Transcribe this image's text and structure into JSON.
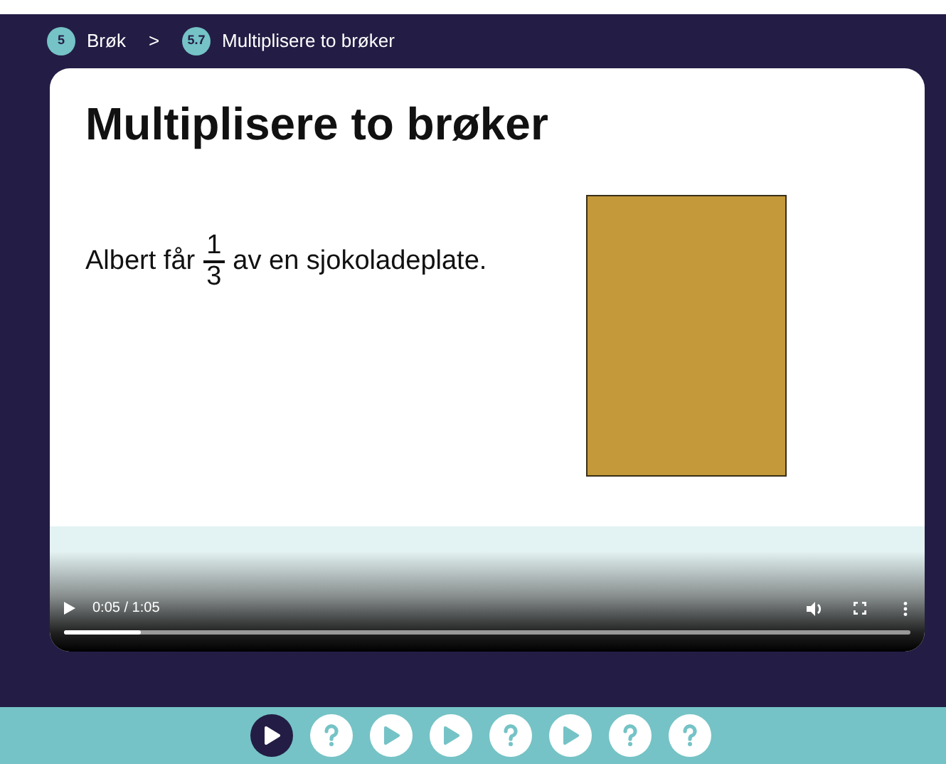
{
  "breadcrumb": [
    {
      "badge": "5",
      "label": "Brøk"
    },
    {
      "badge": "5.7",
      "label": "Multiplisere to brøker"
    }
  ],
  "breadcrumb_separator": ">",
  "video": {
    "slide": {
      "title": "Multiplisere to brøker",
      "text_before": "Albert får",
      "fraction": {
        "numerator": "1",
        "denominator": "3"
      },
      "text_after": "av en sjokoladeplate."
    },
    "time": "0:05 / 1:05",
    "level": 0.09
  },
  "steps": [
    {
      "kind": "play",
      "selected": true
    },
    {
      "kind": "quiz",
      "selected": false
    },
    {
      "kind": "play",
      "selected": false
    },
    {
      "kind": "play",
      "selected": false
    },
    {
      "kind": "quiz",
      "selected": false
    },
    {
      "kind": "play",
      "selected": false
    },
    {
      "kind": "quiz",
      "selected": false
    },
    {
      "kind": "quiz",
      "selected": false
    }
  ]
}
